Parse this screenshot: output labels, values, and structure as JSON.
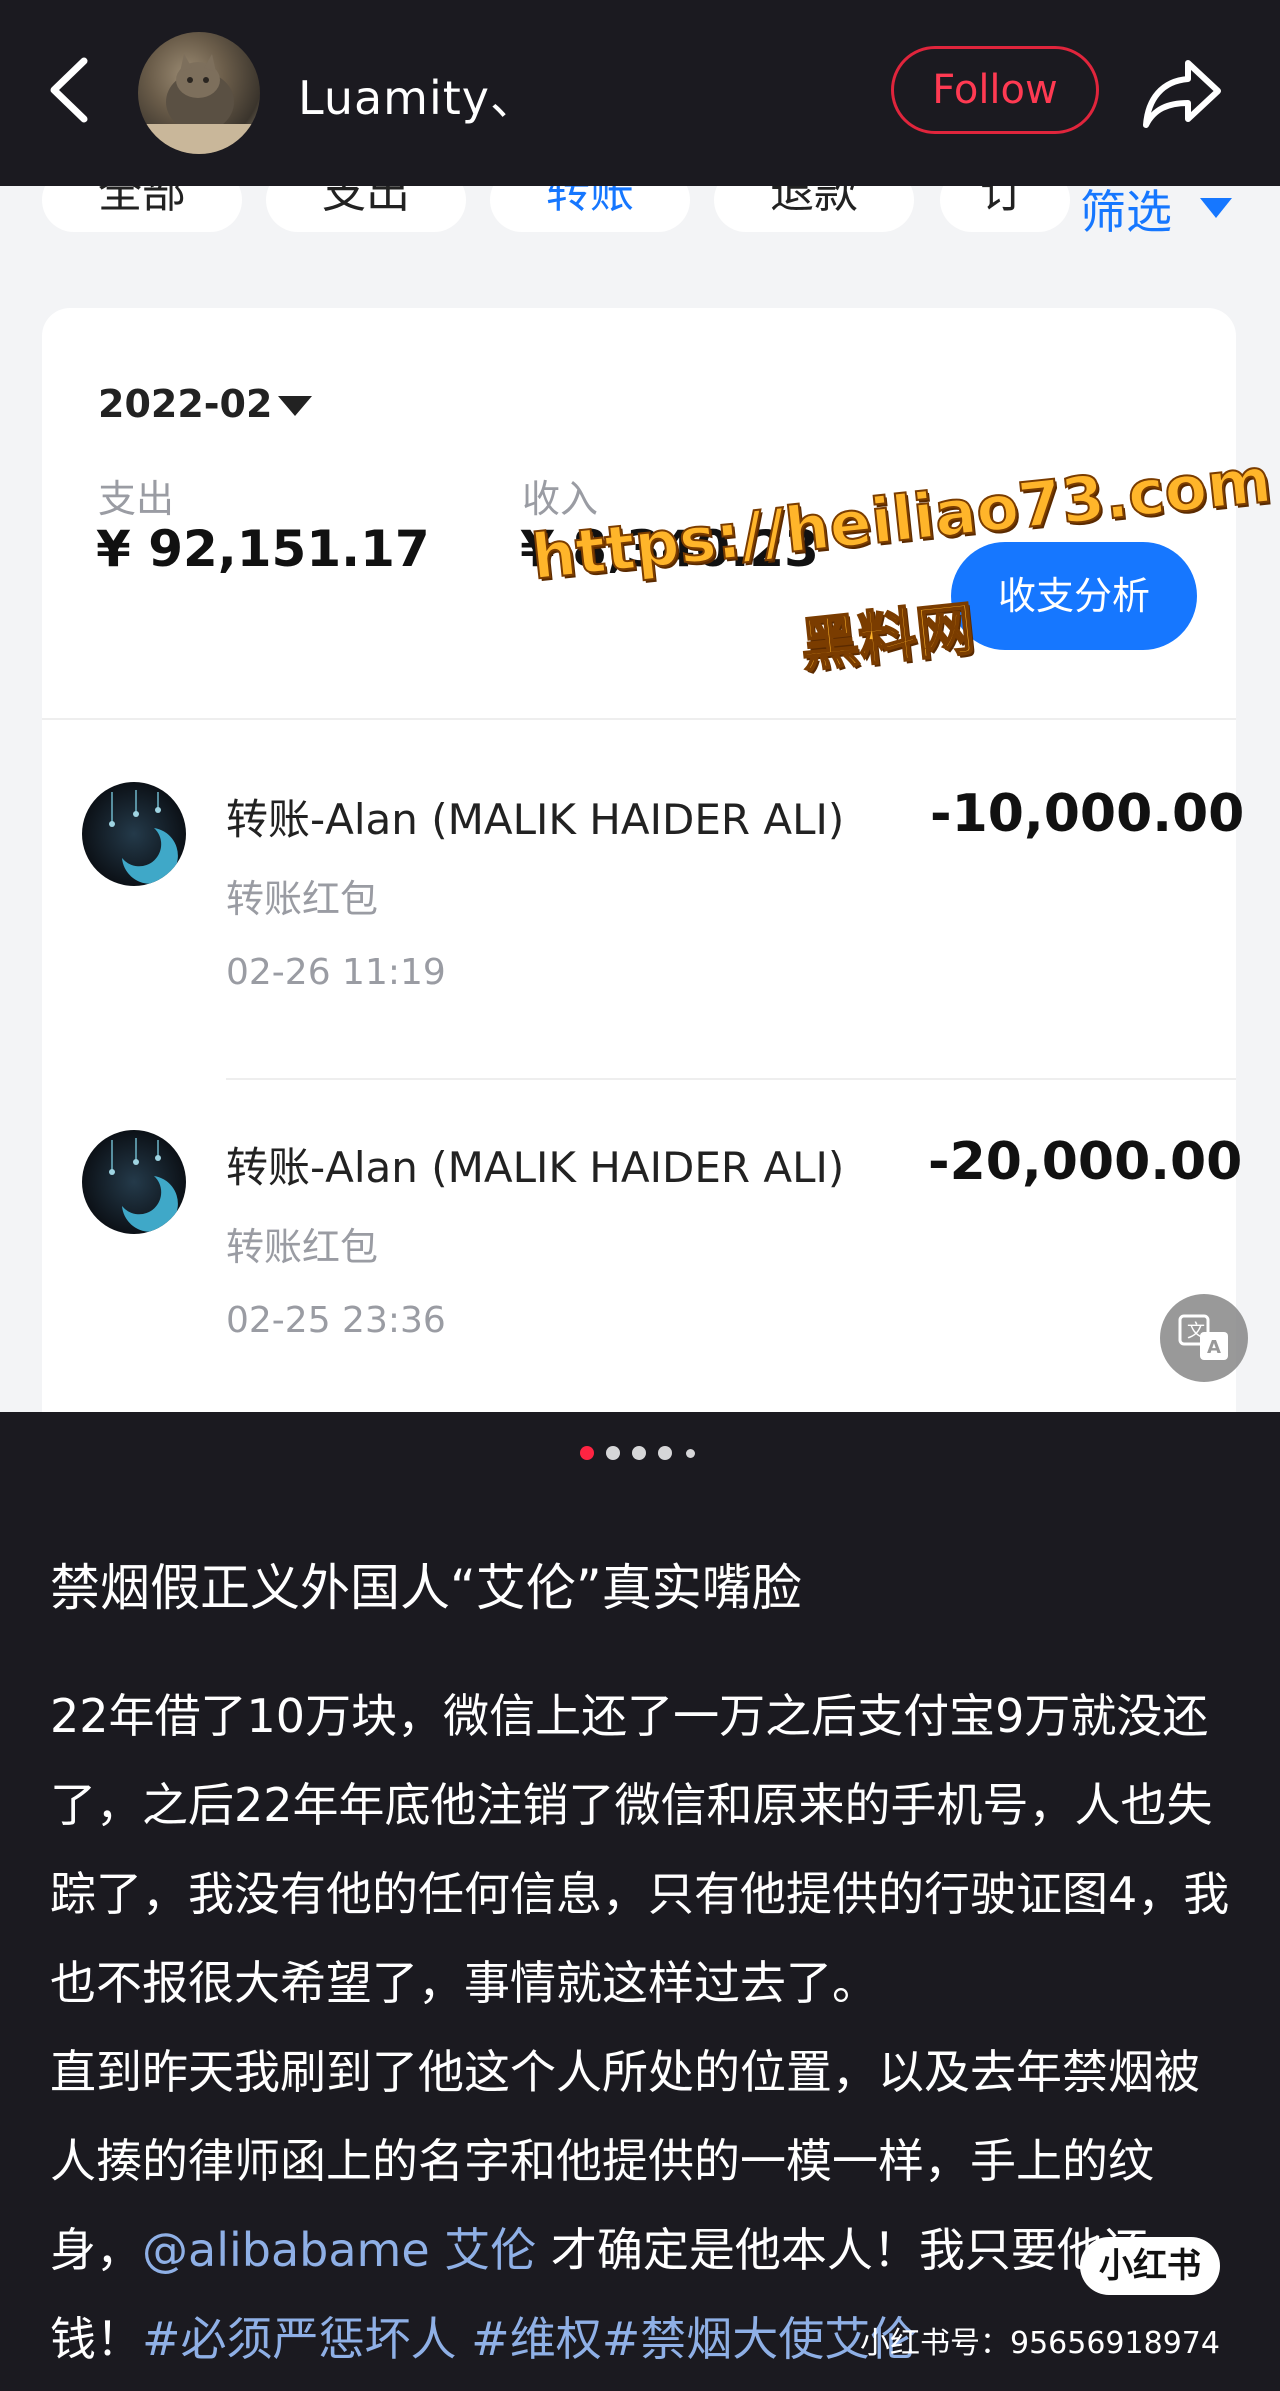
{
  "header": {
    "username": "Luamity、",
    "follow_label": "Follow"
  },
  "screenshot": {
    "filter_chips": [
      "全部",
      "支出",
      "转账",
      "退款",
      "订"
    ],
    "active_chip": "转账",
    "filter_label": "筛选",
    "month": "2022-02",
    "expense_label": "支出",
    "expense_amount": "¥ 92,151.17",
    "income_label": "收入",
    "income_amount": "¥ 8,340.23",
    "analysis_button": "收支分析",
    "transactions": [
      {
        "name": "转账-Alan (MALIK HAIDER ALI)",
        "sub": "转账红包",
        "time": "02-26 11:19",
        "amount": "-10,000.00"
      },
      {
        "name": "转账-Alan (MALIK HAIDER ALI)",
        "sub": "转账红包",
        "time": "02-25 23:36",
        "amount": "-20,000.00"
      }
    ],
    "watermark_url": "https://heiliao73.com",
    "watermark_cn": "黑料网"
  },
  "carousel": {
    "total": 5,
    "active": 0,
    "active_color": "#ff2442"
  },
  "post": {
    "title": "禁烟假正义外国人“艾伦”真实嘴脸",
    "para1": "22年借了10万块，微信上还了一万之后支付宝9万就没还了，之后22年年底他注销了微信和原来的手机号，人也失踪了，我没有他的任何信息，只有他提供的行驶证图4，我也不报很大希望了，事情就这样过去了。",
    "para2_prefix": "直到昨天我刷到了他这个人所处的位置，以及去年禁烟被人揍的律师函上的名字和他提供的一模一样，手上的纹身，",
    "mention": "@alibabame 艾伦",
    "para2_mid": " 才确定是他本人！我只要他还钱！",
    "tag1": "#必须严惩坏人",
    "tag2": "#维权",
    "tag3": "#禁烟大使艾伦",
    "badge": "小红书",
    "xhs_id": "小红书号：95656918974"
  },
  "colors": {
    "follow_red": "#e0253c",
    "blue": "#1677ff",
    "watermark": "#ffb52a"
  }
}
